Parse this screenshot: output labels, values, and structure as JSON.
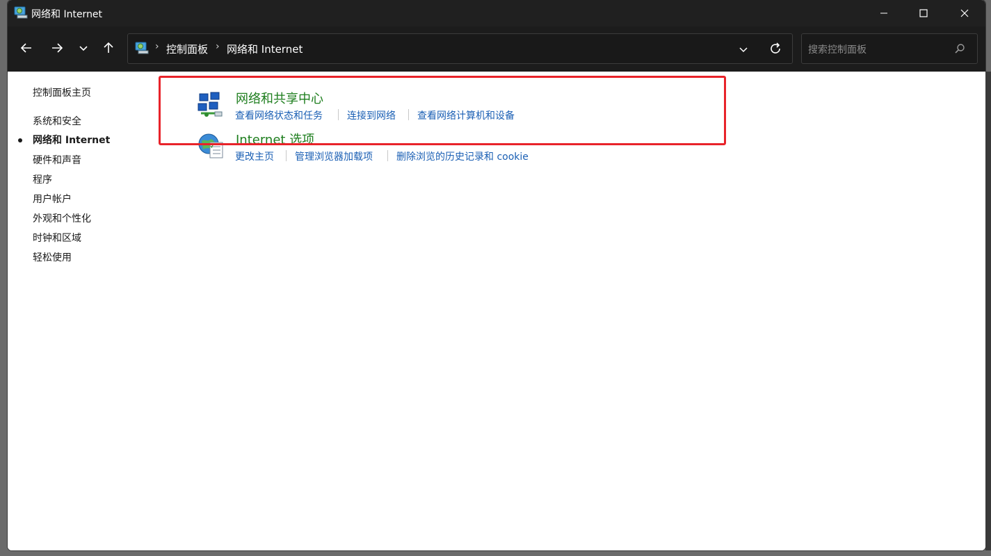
{
  "window": {
    "title": "网络和 Internet",
    "colors": {
      "titlebar": "#202020",
      "toolbar": "#1c1c1c",
      "link": "#1a5fb4",
      "category": "#1e7e1e",
      "highlight": "#e8232a"
    }
  },
  "titlebar": {
    "icon": "network-folder-icon",
    "minimize_icon": "minimize-icon",
    "maximize_icon": "maximize-icon",
    "close_icon": "close-icon"
  },
  "toolbar": {
    "back_icon": "back-arrow-icon",
    "forward_icon": "forward-arrow-icon",
    "recent_icon": "chevron-down-icon",
    "up_icon": "up-arrow-icon",
    "breadcrumbs": [
      "控制面板",
      "网络和 Internet"
    ],
    "search_placeholder": "搜索控制面板"
  },
  "sidebar": {
    "items": [
      {
        "label": "控制面板主页"
      },
      {
        "label": "系统和安全"
      },
      {
        "label": "网络和 Internet",
        "active": true
      },
      {
        "label": "硬件和声音"
      },
      {
        "label": "程序"
      },
      {
        "label": "用户帐户"
      },
      {
        "label": "外观和个性化"
      },
      {
        "label": "时钟和区域"
      },
      {
        "label": "轻松使用"
      }
    ]
  },
  "categories": [
    {
      "title": "网络和共享中心",
      "icon": "network-sharing-center-icon",
      "links": [
        "查看网络状态和任务",
        "连接到网络",
        "查看网络计算机和设备"
      ]
    },
    {
      "title": "Internet 选项",
      "icon": "internet-options-icon",
      "links": [
        "更改主页",
        "管理浏览器加载项",
        "删除浏览的历史记录和 cookie"
      ]
    }
  ]
}
